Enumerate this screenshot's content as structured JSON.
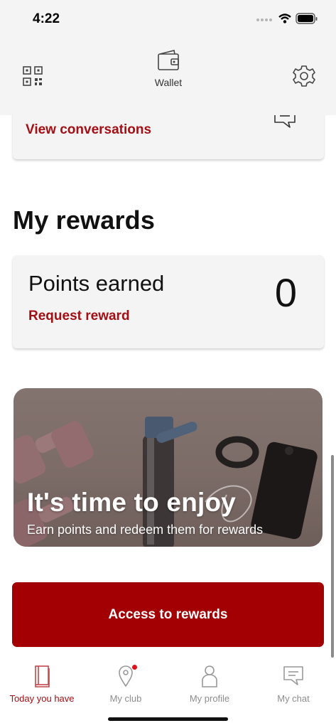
{
  "status_bar": {
    "time": "4:22"
  },
  "header": {
    "wallet_label": "Wallet",
    "icons": {
      "left": "qr-code-icon",
      "center": "wallet-icon",
      "right": "gear-icon"
    }
  },
  "conversations": {
    "link": "View conversations",
    "icon": "chat-icon"
  },
  "rewards": {
    "title": "My rewards",
    "points_label": "Points earned",
    "points_value": "0",
    "request_link": "Request reward"
  },
  "promo": {
    "title": "It's time to enjoy",
    "subtitle": "Earn points and redeem them for rewards"
  },
  "cta": {
    "label": "Access to rewards"
  },
  "tabs": [
    {
      "label": "Today you have",
      "icon": "notebook-icon",
      "active": true
    },
    {
      "label": "My club",
      "icon": "location-pin-icon",
      "active": false,
      "badge": true
    },
    {
      "label": "My profile",
      "icon": "person-icon",
      "active": false
    },
    {
      "label": "My chat",
      "icon": "chat-icon",
      "active": false
    }
  ],
  "colors": {
    "accent": "#a30f14",
    "button": "#a30003",
    "header_bg": "#f4f4f4",
    "badge": "#e0121a"
  }
}
